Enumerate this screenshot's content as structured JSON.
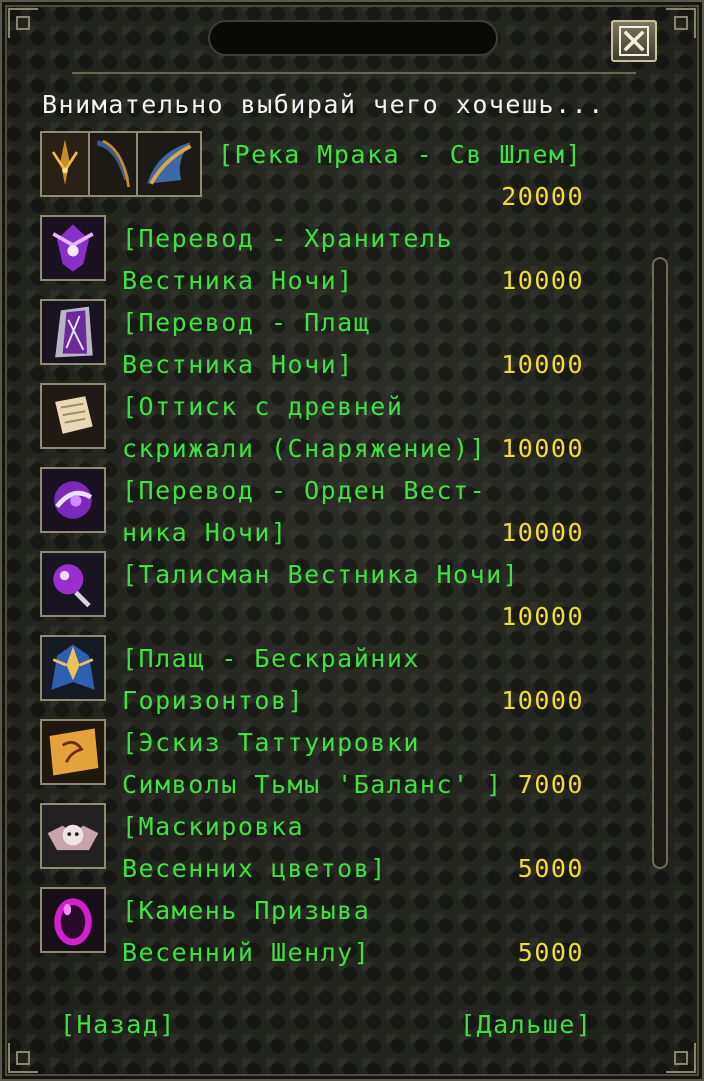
{
  "dialog": {
    "prompt": "Внимательно выбирай чего хочешь...",
    "close_icon": "close-x-icon",
    "back_label": "[Назад]",
    "next_label": "[Дальше]"
  },
  "items": [
    {
      "name_line1": "[Река Мрака - Св Шлем]",
      "name_line2": "",
      "price": "20000",
      "icon": "helmet-set-icon"
    },
    {
      "name_line1": "[Перевод - Хранитель",
      "name_line2": "Вестника Ночи]",
      "price": "10000",
      "icon": "purple-guardian-icon"
    },
    {
      "name_line1": "[Перевод - Плащ",
      "name_line2": "Вестника Ночи]",
      "price": "10000",
      "icon": "purple-cloak-icon"
    },
    {
      "name_line1": "[Оттиск с древней",
      "name_line2": "скрижали (Снаряжение)]",
      "price": "10000",
      "icon": "scroll-icon"
    },
    {
      "name_line1": "[Перевод - Орден Вест-",
      "name_line2": "ника Ночи]",
      "price": "10000",
      "icon": "purple-order-icon"
    },
    {
      "name_line1": "[Талисман Вестника Ночи]",
      "name_line2": "",
      "price": "10000",
      "icon": "talisman-icon"
    },
    {
      "name_line1": "[Плащ - Бескрайних",
      "name_line2": "Горизонтов]",
      "price": "10000",
      "icon": "blue-cloak-icon"
    },
    {
      "name_line1": "[Эскиз Таттуировки",
      "name_line2": "Символы Тьмы 'Баланс' ]",
      "price": "7000",
      "icon": "tattoo-sketch-icon"
    },
    {
      "name_line1": "[Маскировка",
      "name_line2": "Весенних цветов]",
      "price": "5000",
      "icon": "bat-costume-icon"
    },
    {
      "name_line1": "[Камень Призыва",
      "name_line2": "Весенний Шенлу]",
      "price": "5000",
      "icon": "summon-egg-icon"
    }
  ]
}
